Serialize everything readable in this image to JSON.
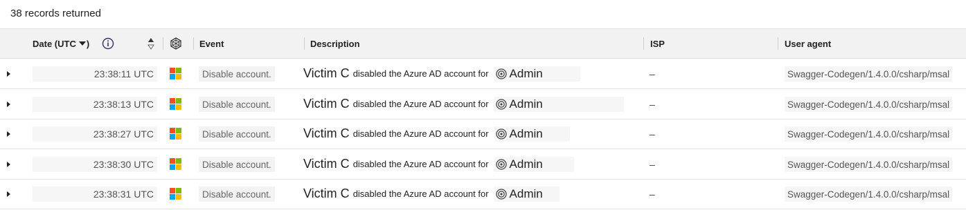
{
  "summary": {
    "records_text": "38 records returned"
  },
  "header": {
    "date_label": "Date (UTC",
    "event_label": "Event",
    "description_label": "Description",
    "isp_label": "ISP",
    "user_agent_label": "User agent"
  },
  "colors": {
    "ms_red": "#f25022",
    "ms_green": "#7fba00",
    "ms_blue": "#00a4ef",
    "ms_yellow": "#ffb900"
  },
  "rows": [
    {
      "time": "23:38:11 UTC",
      "event": "Disable account.",
      "actor": "Victim C",
      "action": "disabled the Azure AD account for",
      "target": "Admin",
      "isp": "–",
      "user_agent": "Swagger-Codegen/1.4.0.0/csharp/msal"
    },
    {
      "time": "23:38:13 UTC",
      "event": "Disable account.",
      "actor": "Victim C",
      "action": "disabled the Azure AD account for",
      "target": "Admin",
      "isp": "–",
      "user_agent": "Swagger-Codegen/1.4.0.0/csharp/msal"
    },
    {
      "time": "23:38:27 UTC",
      "event": "Disable account.",
      "actor": "Victim C",
      "action": "disabled the Azure AD account for",
      "target": "Admin",
      "isp": "–",
      "user_agent": "Swagger-Codegen/1.4.0.0/csharp/msal"
    },
    {
      "time": "23:38:30 UTC",
      "event": "Disable account.",
      "actor": "Victim C",
      "action": "disabled the Azure AD account for",
      "target": "Admin",
      "isp": "–",
      "user_agent": "Swagger-Codegen/1.4.0.0/csharp/msal"
    },
    {
      "time": "23:38:31 UTC",
      "event": "Disable account.",
      "actor": "Victim C",
      "action": "disabled the Azure AD account for",
      "target": "Admin",
      "isp": "–",
      "user_agent": "Swagger-Codegen/1.4.0.0/csharp/msal"
    }
  ]
}
